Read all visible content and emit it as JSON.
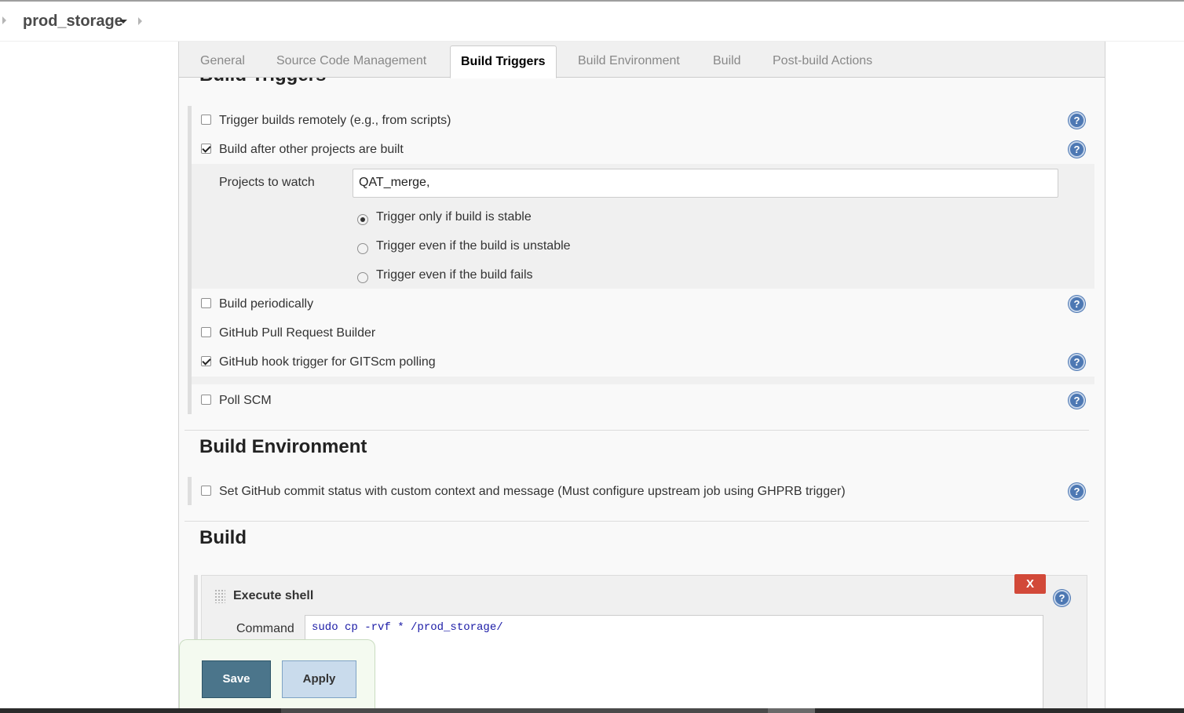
{
  "breadcrumb": {
    "project": "prod_storage"
  },
  "tabs": [
    {
      "label": "General"
    },
    {
      "label": "Source Code Management"
    },
    {
      "label": "Build Triggers"
    },
    {
      "label": "Build Environment"
    },
    {
      "label": "Build"
    },
    {
      "label": "Post-build Actions"
    }
  ],
  "active_tab": "Build Triggers",
  "build_triggers": {
    "title": "Build Triggers",
    "remote": {
      "label": "Trigger builds remotely (e.g., from scripts)",
      "checked": false
    },
    "after_other": {
      "label": "Build after other projects are built",
      "checked": true
    },
    "projects_label": "Projects to watch",
    "projects_value": "QAT_merge,",
    "radios": [
      {
        "label": "Trigger only if build is stable",
        "checked": true
      },
      {
        "label": "Trigger even if the build is unstable",
        "checked": false
      },
      {
        "label": "Trigger even if the build fails",
        "checked": false
      }
    ],
    "periodically": {
      "label": "Build periodically",
      "checked": false
    },
    "ghprb": {
      "label": "GitHub Pull Request Builder",
      "checked": false
    },
    "hook": {
      "label": "GitHub hook trigger for GITScm polling",
      "checked": true
    },
    "poll": {
      "label": "Poll SCM",
      "checked": false
    }
  },
  "build_environment": {
    "title": "Build Environment",
    "commit_status": {
      "label": "Set GitHub commit status with custom context and message (Must configure upstream job using GHPRB trigger)",
      "checked": false
    }
  },
  "build": {
    "title": "Build",
    "step_title": "Execute shell",
    "delete_label": "X",
    "command_label": "Command",
    "command": "sudo cp -rvf * /prod_storage/"
  },
  "actions": {
    "save": "Save",
    "apply": "Apply"
  },
  "help_glyph": "?",
  "colors": {
    "help_icon": "#4d78b3",
    "save_button": "#4b758b",
    "apply_button": "#c9dbec",
    "delete_button": "#d24939"
  }
}
